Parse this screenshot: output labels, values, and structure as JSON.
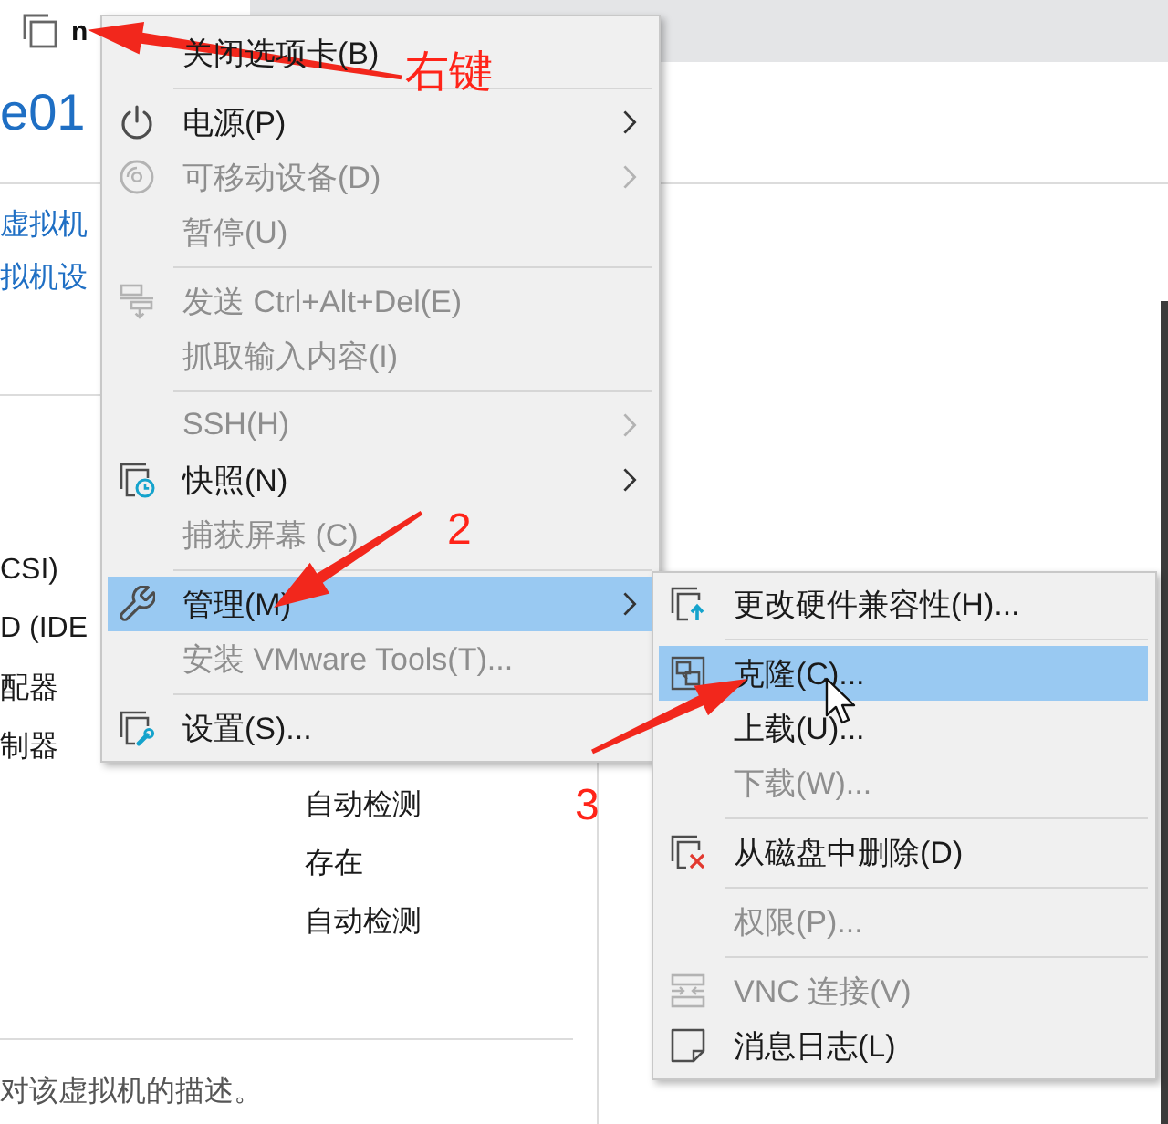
{
  "tab": {
    "title": "n"
  },
  "header": {
    "title": "e01"
  },
  "links": [
    {
      "label": "虚拟机"
    },
    {
      "label": "拟机设"
    }
  ],
  "devices": [
    {
      "name": "CSI)"
    },
    {
      "name": "D (IDE"
    },
    {
      "name": "配器"
    },
    {
      "name": "制器"
    },
    {
      "value": "自动检测"
    },
    {
      "value": "存在"
    },
    {
      "value": "自动检测"
    }
  ],
  "description": "对该虚拟机的描述。",
  "context_menu": {
    "items": [
      {
        "kind": "item",
        "label": "关闭选项卡(B)",
        "disabled": false,
        "selected": false,
        "submenu": false
      },
      {
        "kind": "separator"
      },
      {
        "kind": "item",
        "label": "电源(P)",
        "disabled": false,
        "selected": false,
        "submenu": true
      },
      {
        "kind": "item",
        "label": "可移动设备(D)",
        "disabled": true,
        "selected": false,
        "submenu": true
      },
      {
        "kind": "item",
        "label": "暂停(U)",
        "disabled": true,
        "selected": false,
        "submenu": false
      },
      {
        "kind": "separator"
      },
      {
        "kind": "item",
        "label": "发送 Ctrl+Alt+Del(E)",
        "disabled": true,
        "selected": false,
        "submenu": false
      },
      {
        "kind": "item",
        "label": "抓取输入内容(I)",
        "disabled": true,
        "selected": false,
        "submenu": false
      },
      {
        "kind": "separator"
      },
      {
        "kind": "item",
        "label": "SSH(H)",
        "disabled": true,
        "selected": false,
        "submenu": true
      },
      {
        "kind": "item",
        "label": "快照(N)",
        "disabled": false,
        "selected": false,
        "submenu": true
      },
      {
        "kind": "item",
        "label": "捕获屏幕 (C)",
        "disabled": true,
        "selected": false,
        "submenu": false
      },
      {
        "kind": "separator"
      },
      {
        "kind": "item",
        "label": "管理(M)",
        "disabled": false,
        "selected": true,
        "submenu": true
      },
      {
        "kind": "item",
        "label": "安装 VMware Tools(T)...",
        "disabled": true,
        "selected": false,
        "submenu": false
      },
      {
        "kind": "separator"
      },
      {
        "kind": "item",
        "label": "设置(S)...",
        "disabled": false,
        "selected": false,
        "submenu": false
      }
    ]
  },
  "submenu": {
    "items": [
      {
        "kind": "item",
        "label": "更改硬件兼容性(H)...",
        "disabled": false,
        "selected": false
      },
      {
        "kind": "separator"
      },
      {
        "kind": "item",
        "label": "克隆(C)...",
        "disabled": false,
        "selected": true
      },
      {
        "kind": "item",
        "label": "上载(U)...",
        "disabled": false,
        "selected": false
      },
      {
        "kind": "item",
        "label": "下载(W)...",
        "disabled": true,
        "selected": false
      },
      {
        "kind": "separator"
      },
      {
        "kind": "item",
        "label": "从磁盘中删除(D)",
        "disabled": false,
        "selected": false
      },
      {
        "kind": "separator"
      },
      {
        "kind": "item",
        "label": "权限(P)...",
        "disabled": true,
        "selected": false
      },
      {
        "kind": "separator"
      },
      {
        "kind": "item",
        "label": "VNC 连接(V)",
        "disabled": true,
        "selected": false
      },
      {
        "kind": "item",
        "label": "消息日志(L)",
        "disabled": false,
        "selected": false
      }
    ]
  },
  "annotations": [
    {
      "text": "右键"
    },
    {
      "text": "2"
    },
    {
      "text": "3"
    }
  ]
}
